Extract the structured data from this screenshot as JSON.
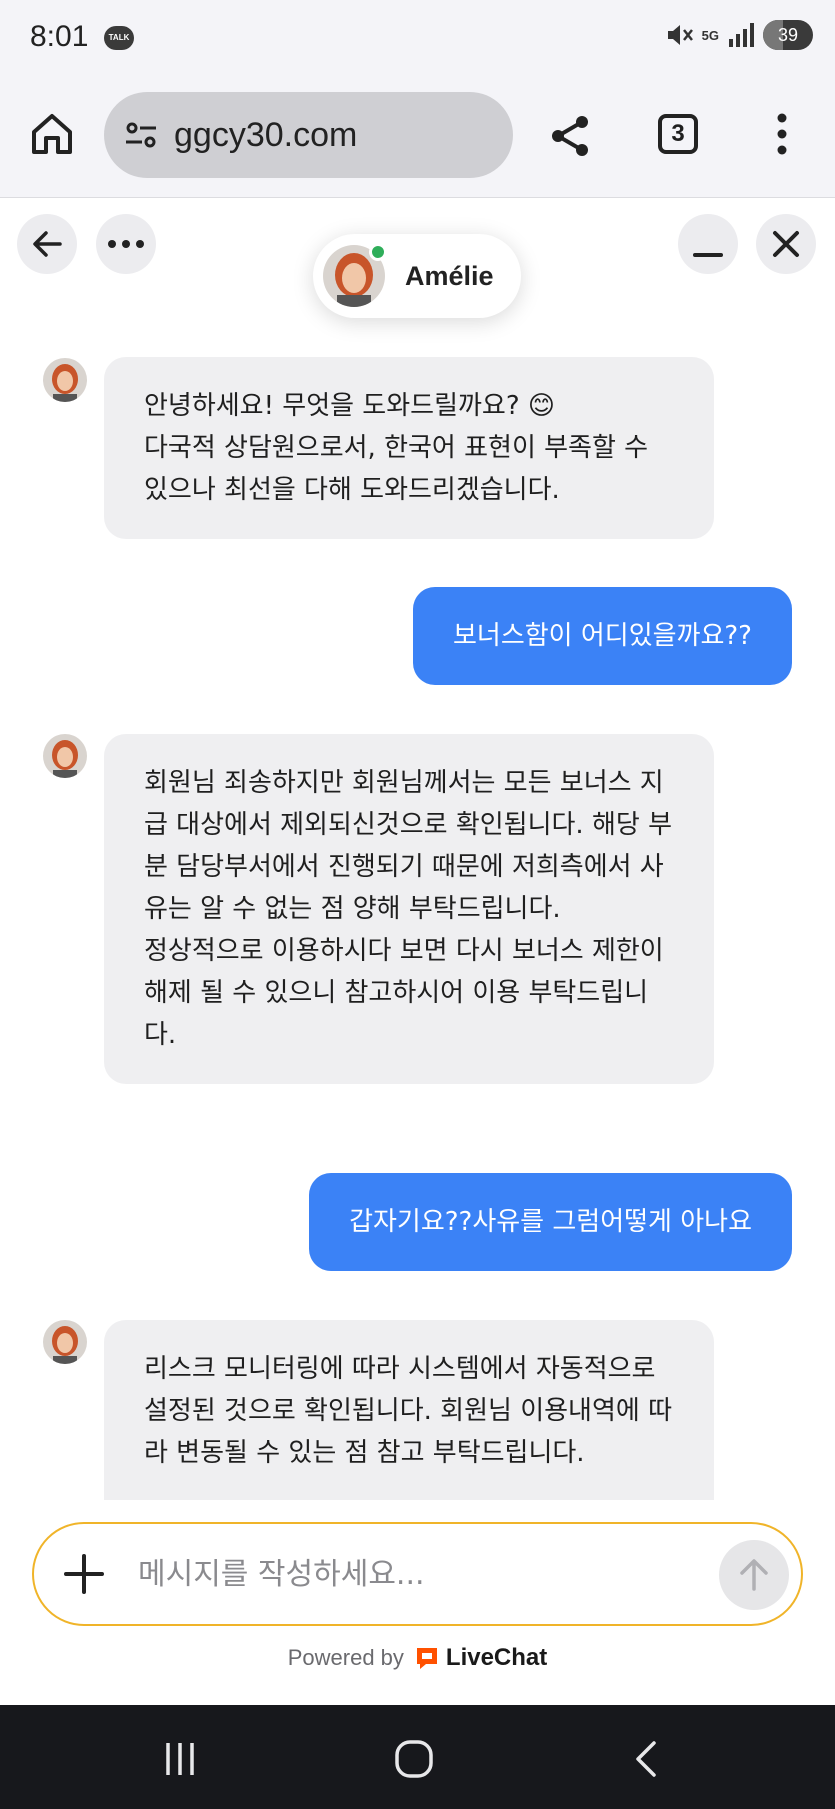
{
  "status_bar": {
    "time": "8:01",
    "talk_badge": "TALK",
    "network": "5G",
    "battery": "39",
    "battery_level": 0.39
  },
  "browser": {
    "url": "ggcy30.com",
    "tab_count": "3"
  },
  "chat": {
    "agent_name": "Amélie",
    "agent_online": true,
    "messages": [
      {
        "sender": "agent",
        "text": "안녕하세요! 무엇을 도와드릴까요? 😊\n다국적 상담원으로서, 한국어 표현이 부족할 수 있으나 최선을 다해 도와드리겠습니다."
      },
      {
        "sender": "user",
        "text": "보너스함이 어디있을까요??"
      },
      {
        "sender": "agent",
        "text": "회원님 죄송하지만 회원님께서는 모든 보너스 지급 대상에서 제외되신것으로 확인됩니다. 해당 부분 담당부서에서 진행되기 때문에 저희측에서 사유는 알 수 없는 점 양해 부탁드립니다.\n정상적으로 이용하시다 보면 다시 보너스 제한이 해제 될 수 있으니 참고하시어 이용 부탁드립니다."
      },
      {
        "sender": "user",
        "text": "갑자기요??사유를 그럼어떻게 아나요"
      },
      {
        "sender": "agent",
        "text": "리스크 모니터링에 따라 시스템에서 자동적으로 설정된 것으로 확인됩니다. 회원님 이용내역에 따라 변동될 수 있는 점 참고 부탁드립니다."
      }
    ],
    "composer_placeholder": "메시지를 작성하세요...",
    "powered_by": "Powered by",
    "brand": "LiveChat",
    "colors": {
      "user_bubble": "#3b82f6",
      "agent_bubble": "#efeff1",
      "composer_border": "#f0b429",
      "livechat_orange": "#ff5100",
      "online": "#2fae5a"
    }
  }
}
